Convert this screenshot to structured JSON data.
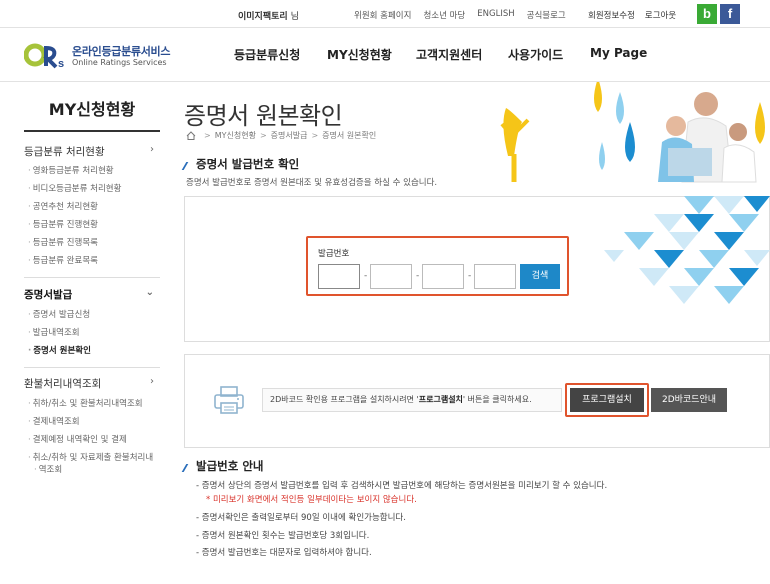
{
  "topbar": {
    "user_name": "이미지팩토리",
    "user_suffix": "님",
    "links": [
      "위원회 홈페이지",
      "청소년 마당",
      "ENGLISH",
      "공식블로그"
    ],
    "account": [
      "회원정보수정",
      "로그아웃"
    ],
    "sns": {
      "blog": "b",
      "facebook": "f"
    }
  },
  "logo": {
    "ko": "온라인등급분류서비스",
    "en": "Online Ratings Services"
  },
  "gnb": [
    "등급분류신청",
    "MY신청현황",
    "고객지원센터",
    "사용가이드",
    "My Page"
  ],
  "lnb": {
    "title": "MY신청현황",
    "groups": [
      {
        "label": "등급분류 처리현황",
        "items": [
          "영화등급분류 처리현황",
          "비디오등급분류 처리현황",
          "공연추천 처리현황",
          "등급분류 진행현황",
          "등급분류 진행목록",
          "등급분류 완료목록"
        ]
      },
      {
        "label": "증명서발급",
        "items": [
          "증명서 발급신청",
          "발급내역조회",
          "증명서 원본확인"
        ]
      },
      {
        "label": "환불처리내역조회",
        "items": [
          "취하/취소 및 환불처리내역조회",
          "결제내역조회",
          "결제예정 내역확인 및 결제",
          "취소/취하 및 자료제출 환불처리내",
          "역조회"
        ]
      }
    ]
  },
  "page": {
    "title": "증명서 원본확인",
    "breadcrumb": [
      "MY신청현황",
      "증명서발급",
      "증명서 원본확인"
    ]
  },
  "section1": {
    "title": "증명서 발급번호 확인",
    "desc": "증명서 발급번호로 증명서 원본대조 및 유효성검증을 하실 수 있습니다.",
    "field_label": "발급번호",
    "inputs": [
      "",
      "",
      "",
      ""
    ],
    "search_button": "검색"
  },
  "section2": {
    "message_prefix": "2D바코드 확인용 프로그램을 설치하시려면 '",
    "message_bold": "프로그램설치",
    "message_suffix": "' 버튼을 클릭하세요.",
    "install_button": "프로그램설치",
    "guide_button": "2D바코드안내"
  },
  "section3": {
    "title": "발급번호 안내",
    "items": [
      "- 증명서 상단의 증명서 발급번호를 입력 후 검색하시면 발급번호에 해당하는 증명서원본을 미리보기 할 수 있습니다.",
      "* 미리보기 화면에서 적인등 일부데이타는 보이지 않습니다.",
      "- 증명서확인은 출력일로부터 90일 이내에 확인가능합니다.",
      "- 증명서 원본확인 횟수는 발급번호당 3회입니다.",
      "- 증명서 발급번호는 대문자로 입력하셔야 합니다."
    ]
  },
  "colors": {
    "accent_blue": "#1e88c8",
    "highlight_red": "#e0542d",
    "notice_red": "#d9322a"
  }
}
